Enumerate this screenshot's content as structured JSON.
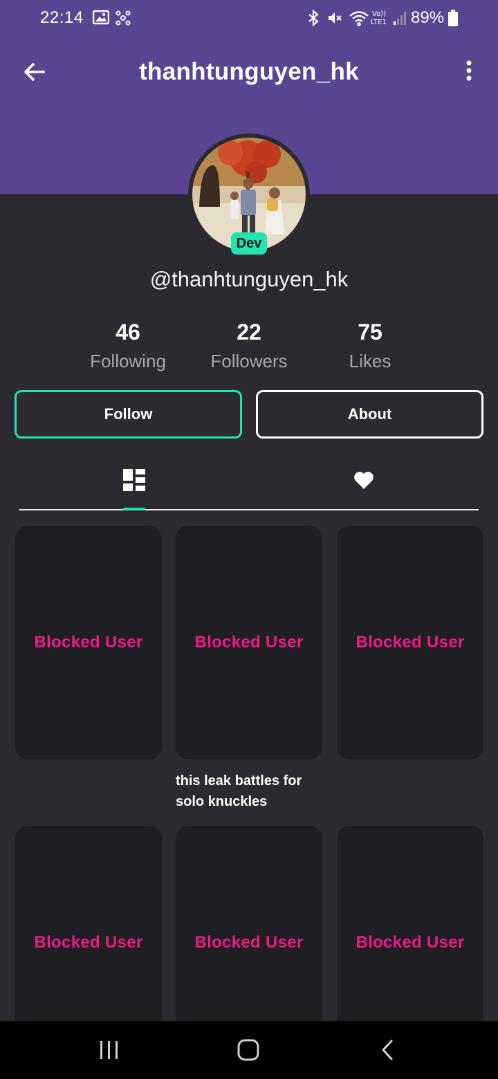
{
  "status_bar": {
    "time": "22:14",
    "battery": "89%"
  },
  "header": {
    "title": "thanhtunguyen_hk"
  },
  "profile": {
    "badge": "Dev",
    "handle": "@thanhtunguyen_hk"
  },
  "stats": [
    {
      "value": "46",
      "label": "Following"
    },
    {
      "value": "22",
      "label": "Followers"
    },
    {
      "value": "75",
      "label": "Likes"
    }
  ],
  "buttons": {
    "follow": "Follow",
    "about": "About"
  },
  "grid": {
    "items": [
      {
        "label": "Blocked User"
      },
      {
        "label": "Blocked User"
      },
      {
        "label": "Blocked User"
      },
      {
        "label": "Blocked User"
      },
      {
        "label": "Blocked User"
      },
      {
        "label": "Blocked User"
      }
    ],
    "caption_line1": "this leak battles for",
    "caption_line2": "solo knuckles"
  },
  "colors": {
    "header_bg": "#5a4592",
    "page_bg": "#2c2a31",
    "accent": "#22e3b1",
    "blocked_text": "#ee1a8b"
  }
}
